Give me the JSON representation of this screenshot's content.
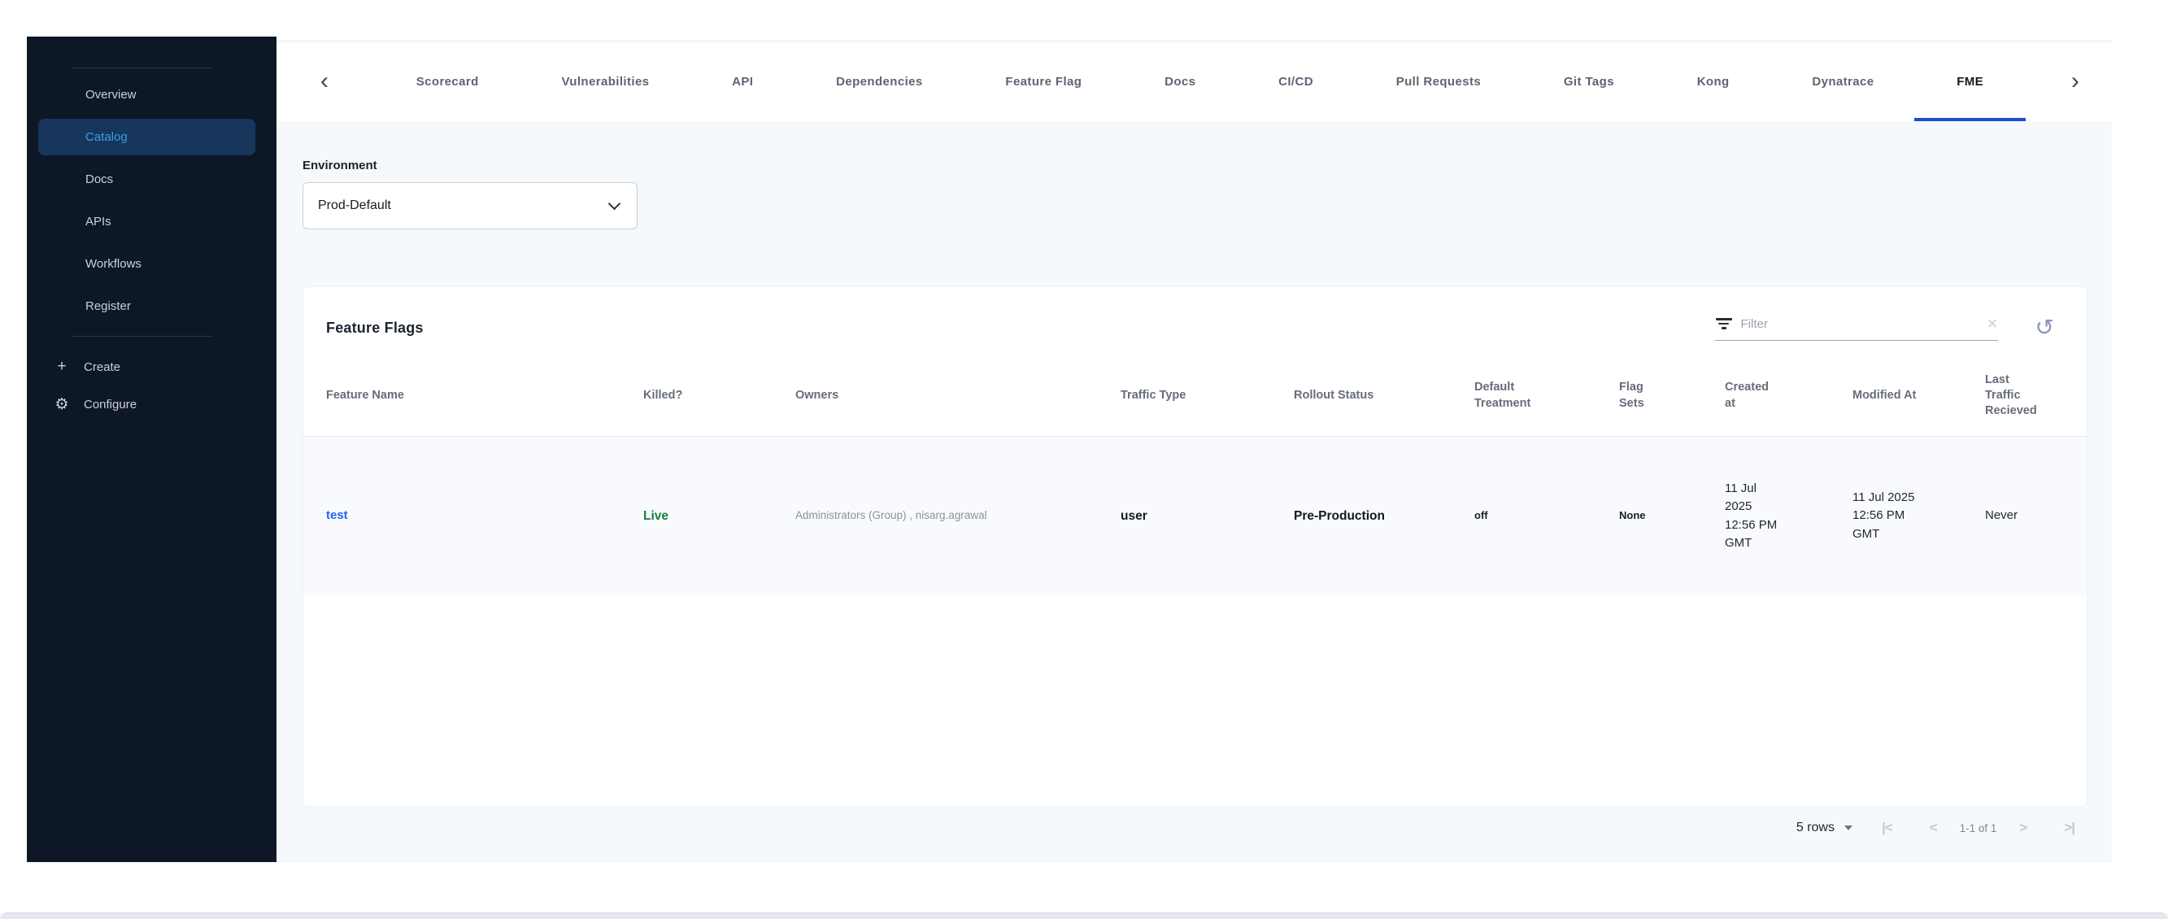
{
  "sidebar": {
    "items": [
      "Overview",
      "Catalog",
      "Docs",
      "APIs",
      "Workflows",
      "Register"
    ],
    "active_item": "Catalog",
    "create_label": "Create",
    "configure_label": "Configure",
    "plus_icon": "+",
    "gear_icon": "⚙"
  },
  "tabs": {
    "back_icon": "‹",
    "forward_icon": "›",
    "items": [
      "Scorecard",
      "Vulnerabilities",
      "API",
      "Dependencies",
      "Feature Flag",
      "Docs",
      "CI/CD",
      "Pull Requests",
      "Git Tags",
      "Kong",
      "Dynatrace",
      "FME"
    ],
    "active": "FME"
  },
  "environment": {
    "label": "Environment",
    "selected": "Prod-Default"
  },
  "feature_flags": {
    "title": "Feature Flags",
    "filter": {
      "placeholder": "Filter",
      "clear_icon": "×",
      "refresh_icon": "↺"
    },
    "table": {
      "columns": [
        "Feature Name",
        "Killed?",
        "Owners",
        "Traffic Type",
        "Rollout Status",
        "Default Treatment",
        "Flag Sets",
        "Created at",
        "Modified At",
        "Last Traffic Recieved"
      ],
      "rows": [
        {
          "feature_name": "test",
          "killed": "Live",
          "owners": "Administrators (Group) , nisarg.agrawal",
          "traffic_type": "user",
          "rollout_status": "Pre-Production",
          "default_treatment": "off",
          "flag_sets": "None",
          "created_at": "11 Jul 2025 12:56 PM GMT",
          "modified_at": "11 Jul 2025 12:56 PM GMT",
          "last_traffic_recieved": "Never"
        }
      ]
    },
    "pagination": {
      "rows_per_page": "5 rows",
      "range": "1-1 of 1",
      "first_icon": "|<",
      "prev_icon": "<",
      "next_icon": ">",
      "last_icon": ">|"
    }
  },
  "colors": {
    "accent_blue": "#1d4ed8",
    "link_blue": "#2563eb",
    "live_green": "#15803d",
    "sidebar_bg": "#0e1726",
    "sidebar_active_bg": "#16365c",
    "sidebar_active_text": "#3b9fdf",
    "content_bg": "#f6f9fc"
  }
}
